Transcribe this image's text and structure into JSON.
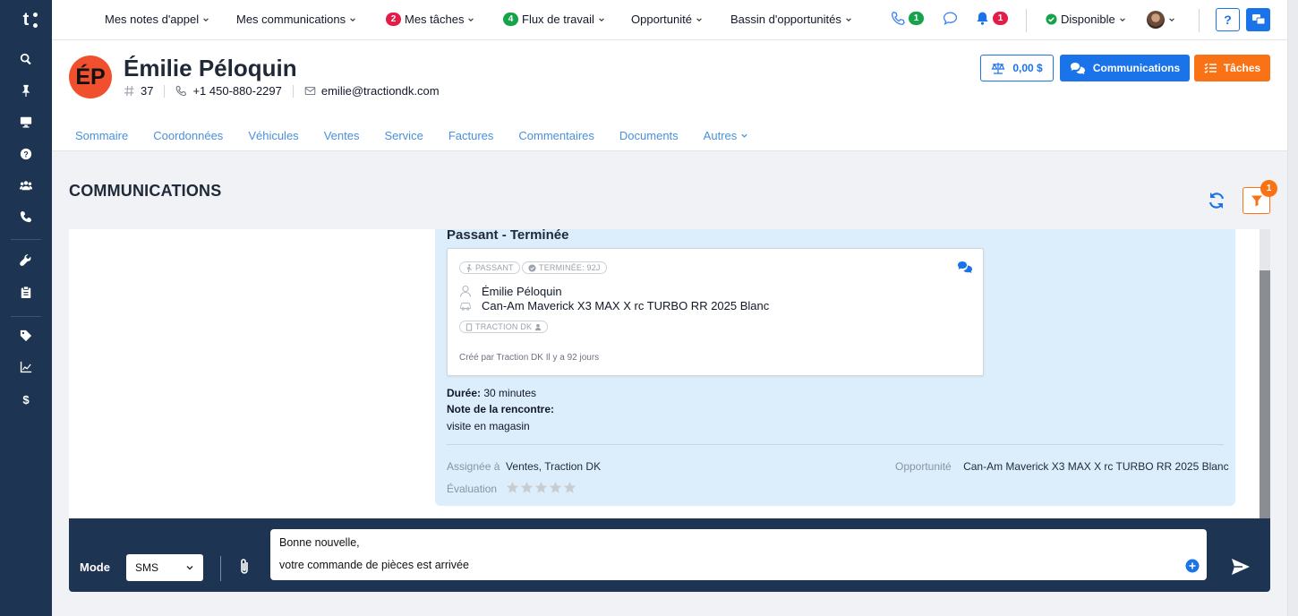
{
  "sidebar": {
    "logo": "t",
    "items": [
      "search-icon",
      "pin-icon",
      "monitor-icon",
      "help-icon",
      "users-icon",
      "phone-icon",
      "wrench-icon",
      "clipboard-icon",
      "tag-icon",
      "chart-icon",
      "dollar-icon"
    ]
  },
  "topnav": {
    "items": [
      {
        "label": "Mes notes d'appel"
      },
      {
        "label": "Mes communications"
      },
      {
        "label": "Mes tâches",
        "badge": "2",
        "badge_color": "#e11d48"
      },
      {
        "label": "Flux de travail",
        "badge": "4",
        "badge_color": "#16a34a"
      },
      {
        "label": "Opportunité"
      },
      {
        "label": "Bassin d'opportunités"
      }
    ],
    "phone_badge": "1",
    "bell_badge": "1",
    "status": "Disponible",
    "help": "?"
  },
  "client": {
    "initials": "ÉP",
    "name": "Émilie Péloquin",
    "id": "37",
    "phone": "+1 450-880-2297",
    "email": "emilie@tractiondk.com",
    "balance": "0,00 $",
    "communications_button": "Communications",
    "tasks_button": "Tâches"
  },
  "tabs": [
    "Sommaire",
    "Coordonnées",
    "Véhicules",
    "Ventes",
    "Service",
    "Factures",
    "Commentaires",
    "Documents",
    "Autres"
  ],
  "section": {
    "title": "COMMUNICATIONS",
    "filter_badge": "1"
  },
  "event": {
    "title": "Passant - Terminée",
    "pill_passant": "PASSANT",
    "pill_terminee": "TERMINÉE: 92J",
    "contact": "Émilie Péloquin",
    "vehicle": "Can-Am Maverick X3 MAX X rc TURBO RR 2025 Blanc",
    "pill_division": "TRACTION DK",
    "created": "Créé par Traction DK Il y a 92 jours",
    "duration_label": "Durée:",
    "duration_value": "30 minutes",
    "note_label": "Note de la rencontre:",
    "note_value": "visite en magasin",
    "assigned_label": "Assignée à",
    "assigned_value": "Ventes, Traction DK",
    "opportunity_label": "Opportunité",
    "opportunity_value": "Can-Am Maverick X3 MAX X rc TURBO RR 2025 Blanc",
    "rating_label": "Évaluation",
    "rating": 0,
    "rating_max": 5
  },
  "composer": {
    "mode_label": "Mode",
    "mode_value": "SMS",
    "message_line1": "Bonne nouvelle,",
    "message_line2": "votre commande de pièces est arrivée"
  },
  "colors": {
    "sidebar": "#1d3452",
    "accent_blue": "#1a73e8",
    "accent_orange": "#f97316",
    "avatar_bg": "#f0502d",
    "event_bg": "#dceefb"
  }
}
